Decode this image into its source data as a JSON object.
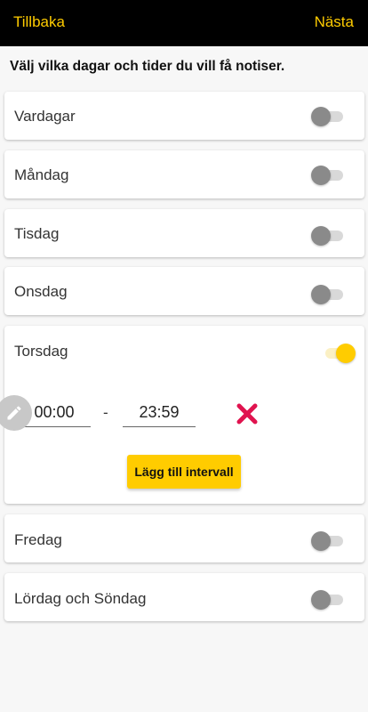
{
  "header": {
    "back_label": "Tillbaka",
    "next_label": "Nästa"
  },
  "instruction": "Välj vilka dagar och tider du vill få notiser.",
  "days": [
    {
      "label": "Vardagar",
      "enabled": false
    },
    {
      "label": "Måndag",
      "enabled": false
    },
    {
      "label": "Tisdag",
      "enabled": false
    },
    {
      "label": "Onsdag",
      "enabled": false
    },
    {
      "label": "Torsdag",
      "enabled": true
    },
    {
      "label": "Fredag",
      "enabled": false
    },
    {
      "label": "Lördag och Söndag",
      "enabled": false
    }
  ],
  "interval": {
    "start": "00:00",
    "separator": "-",
    "end": "23:59"
  },
  "add_interval_label": "Lägg till intervall",
  "colors": {
    "accent": "#ffcc00",
    "delete": "#e0134f",
    "header_bg": "#000000"
  }
}
